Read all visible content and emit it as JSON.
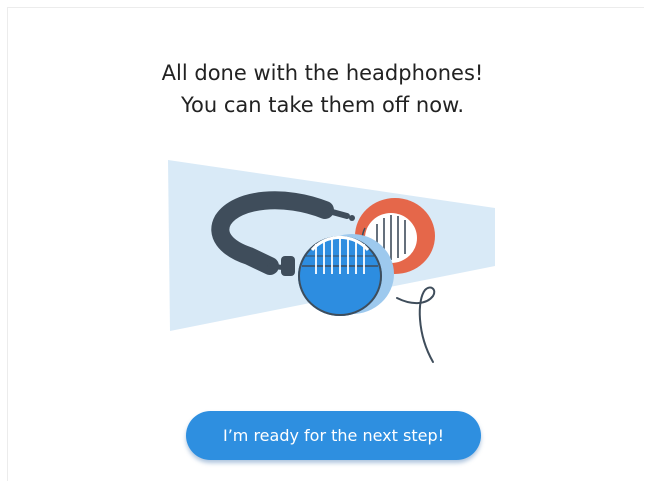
{
  "message": {
    "line1": "All done with the headphones!",
    "line2": "You can take them off now."
  },
  "illustration": {
    "subject": "headphones-icon",
    "colors": {
      "backdrop": "#d9eaf7",
      "headband": "#3f4d5b",
      "ear_cup_front": "#2d8de0",
      "ear_cup_back": "#e5674a",
      "cable": "#3f4d5b"
    }
  },
  "actions": {
    "next_step_label": "I’m ready for the next step!"
  },
  "theme": {
    "accent": "#2e8fe0",
    "text": "#222222",
    "background": "#ffffff"
  }
}
